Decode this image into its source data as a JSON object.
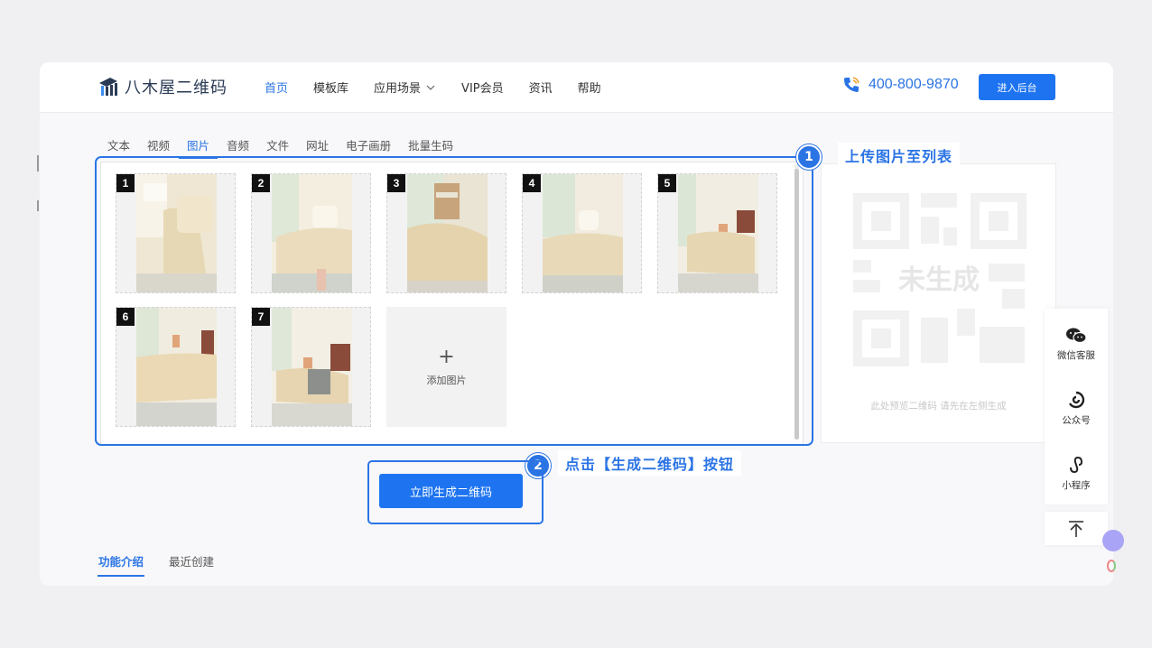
{
  "header": {
    "logo_text": "八木屋二维码",
    "nav": [
      {
        "label": "首页",
        "active": true
      },
      {
        "label": "模板库"
      },
      {
        "label": "应用场景",
        "dropdown": true
      },
      {
        "label": "VIP会员"
      },
      {
        "label": "资讯"
      },
      {
        "label": "帮助"
      }
    ],
    "phone": "400-800-9870",
    "enter_button": "进入后台"
  },
  "tabs": [
    "文本",
    "视频",
    "图片",
    "音频",
    "文件",
    "网址",
    "电子画册",
    "批量生码"
  ],
  "active_tab": "图片",
  "images": [
    "1",
    "2",
    "3",
    "4",
    "5",
    "6",
    "7"
  ],
  "add_image_label": "添加图片",
  "preview": {
    "placeholder_text": "未生成",
    "hint": "此处预览二维码 请先在左侧生成"
  },
  "callouts": {
    "step1_number": "1",
    "step1_text": "上传图片至列表",
    "step2_number": "2",
    "step2_text": "点击【生成二维码】按钮"
  },
  "generate_button": "立即生成二维码",
  "bottom_tabs": [
    "功能介绍",
    "最近创建"
  ],
  "side_panel": {
    "wechat_service": "微信客服",
    "official_account": "公众号",
    "mini_program": "小程序"
  },
  "colors": {
    "accent": "#2b74e4",
    "button": "#1e74f0"
  }
}
